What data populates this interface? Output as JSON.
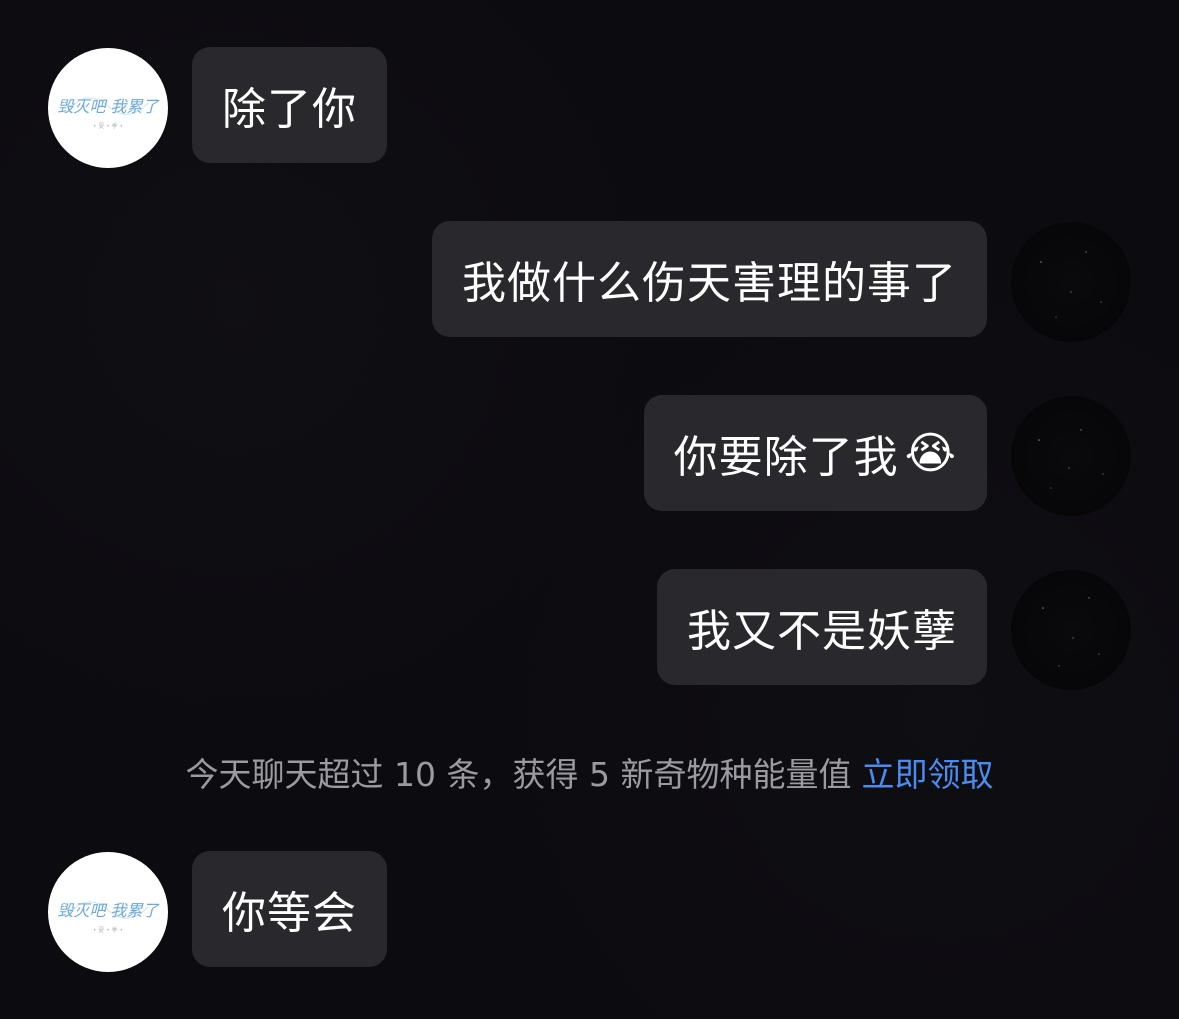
{
  "messages": [
    {
      "side": "left",
      "text": "除了你"
    },
    {
      "side": "right",
      "text": "我做什么伤天害理的事了"
    },
    {
      "side": "right",
      "text": "你要除了我",
      "emoji": "😭"
    },
    {
      "side": "right",
      "text": "我又不是妖孽"
    },
    {
      "side": "left",
      "text": "你等会"
    }
  ],
  "system_notice": {
    "text": "今天聊天超过 10 条，获得 5 新奇物种能量值",
    "action_label": "立即领取"
  },
  "avatars": {
    "left_logo_text": "毁灭吧 我累了",
    "left_logo_subtext": "• 夏 • 季 •"
  },
  "colors": {
    "background": "#0c0b10",
    "bubble": "#29292d",
    "text": "#ffffff",
    "system_text": "#9a9aa0",
    "link": "#4a8cf0",
    "logo_text": "#6aa8e0"
  }
}
